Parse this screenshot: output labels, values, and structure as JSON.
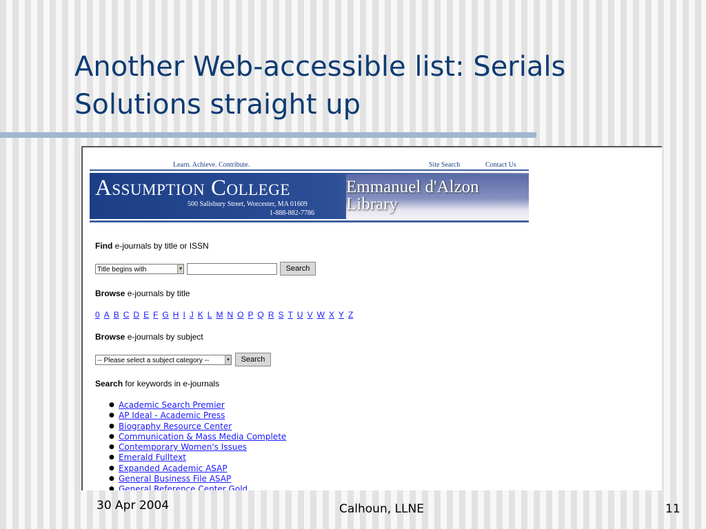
{
  "slide": {
    "title_line1": "Another Web-accessible list: Serials",
    "title_line2": "Solutions straight up",
    "footer_date": "30 Apr 2004",
    "footer_author": "Calhoun, LLNE",
    "footer_page": "11"
  },
  "site": {
    "tagline": "Learn. Achieve. Contribute.",
    "site_search": "Site Search",
    "contact_us": "Contact Us",
    "college_name": "Assumption College",
    "address_line1": "500 Salisbury Street, Worcester, MA 01609",
    "address_line2": "1-888-882-7786",
    "library_line1": "Emmanuel d'Alzon",
    "library_line2": "Library"
  },
  "find": {
    "heading_bold": "Find",
    "heading_rest": " e-journals by title or ISSN",
    "select_value": "Title begins with",
    "search_button": "Search"
  },
  "browse_title": {
    "heading_bold": "Browse",
    "heading_rest": " e-journals by title",
    "letters": [
      "0",
      "A",
      "B",
      "C",
      "D",
      "E",
      "F",
      "G",
      "H",
      "I",
      "J",
      "K",
      "L",
      "M",
      "N",
      "O",
      "P",
      "Q",
      "R",
      "S",
      "T",
      "U",
      "V",
      "W",
      "X",
      "Y",
      "Z"
    ]
  },
  "browse_subject": {
    "heading_bold": "Browse",
    "heading_rest": " e-journals by subject",
    "select_value": "-- Please select a subject category --",
    "search_button": "Search"
  },
  "search_keywords": {
    "heading_bold": "Search",
    "heading_rest": " for keywords in e-journals",
    "databases": [
      "Academic Search Premier",
      "AP Ideal - Academic Press",
      "Biography Resource Center",
      "Communication & Mass Media Complete",
      "Contemporary Women's Issues",
      "Emerald Fulltext",
      "Expanded Academic ASAP",
      "General Business File ASAP",
      "General Reference Center Gold"
    ]
  }
}
